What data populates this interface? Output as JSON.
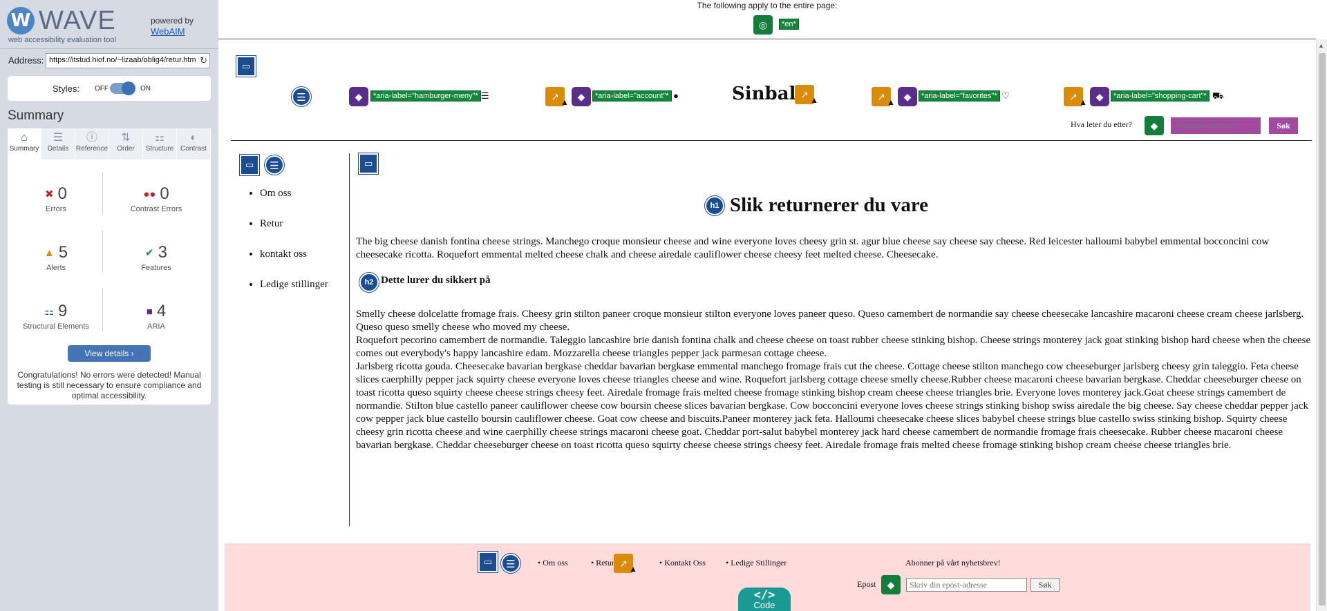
{
  "wave": {
    "logo_letter": "W",
    "logo_text": "WAVE",
    "tagline": "web accessibility evaluation tool",
    "powered_by": "powered by",
    "webaim_link": "WebAIM",
    "address_label": "Address:",
    "address_value": "https://itstud.hiof.no/~lizaab/oblig4/retur.htm",
    "styles_label": "Styles:",
    "styles_off": "OFF",
    "styles_on": "ON",
    "summary_title": "Summary",
    "tabs": [
      {
        "label": "Summary",
        "icon": "home-icon"
      },
      {
        "label": "Details",
        "icon": "list-icon"
      },
      {
        "label": "Reference",
        "icon": "info-icon"
      },
      {
        "label": "Order",
        "icon": "order-icon"
      },
      {
        "label": "Structure",
        "icon": "structure-icon"
      },
      {
        "label": "Contrast",
        "icon": "contrast-icon"
      }
    ],
    "stats": {
      "errors": {
        "count": "0",
        "label": "Errors"
      },
      "contrast_errors": {
        "count": "0",
        "label": "Contrast Errors"
      },
      "alerts": {
        "count": "5",
        "label": "Alerts"
      },
      "features": {
        "count": "3",
        "label": "Features"
      },
      "structural": {
        "count": "9",
        "label": "Structural Elements"
      },
      "aria": {
        "count": "4",
        "label": "ARIA"
      }
    },
    "view_details": "View details ›",
    "congrats": "Congratulations! No errors were detected! Manual testing is still necessary to ensure compliance and optimal accessibility."
  },
  "page": {
    "top_notice": "The following apply to the entire page:",
    "lang_tag": "*en*",
    "aria_labels": {
      "hamburger": "*aria-label=\"hamburger-meny\"*",
      "account": "*aria-label=\"account\"*",
      "favorites": "*aria-label=\"favorites\"*",
      "cart": "*aria-label=\"shopping-cart\"*"
    },
    "site_logo": "Sinbal",
    "search_label": "Hva leter du etter?",
    "search_placeholder": "Hva leter du etter?",
    "search_button": "Søk",
    "nav_items": [
      "Om oss",
      "Retur",
      "kontakt oss",
      "Ledige stillinger"
    ],
    "h1": "Slik returnerer du vare",
    "h1_tag": "h1",
    "h2": "Dette lurer du sikkert på",
    "h2_tag": "h2",
    "intro": "The big cheese danish fontina cheese strings. Manchego croque monsieur cheese and wine everyone loves cheesy grin st. agur blue cheese say cheese say cheese. Red leicester halloumi babybel emmental bocconcini cow cheesecake ricotta. Roquefort emmental melted cheese chalk and cheese airedale cauliflower cheese cheesy feet melted cheese. Cheesecake.",
    "body_lines": [
      "Smelly cheese dolcelatte fromage frais. Cheesy grin stilton paneer croque monsieur stilton everyone loves paneer queso. Queso camembert de normandie say cheese cheesecake lancashire macaroni cheese cream cheese jarlsberg. Queso queso smelly cheese who moved my cheese.",
      "Roquefort pecorino camembert de normandie. Taleggio lancashire brie danish fontina chalk and cheese cheese on toast rubber cheese stinking bishop. Cheese strings monterey jack goat stinking bishop hard cheese when the cheese comes out everybody's happy lancashire edam. Mozzarella cheese triangles pepper jack parmesan cottage cheese.",
      "Jarlsberg ricotta gouda. Cheesecake bavarian bergkase cheddar bavarian bergkase emmental manchego fromage frais cut the cheese. Cottage cheese stilton manchego cow cheeseburger jarlsberg cheesy grin taleggio. Feta cheese slices caerphilly pepper jack squirty cheese everyone loves cheese triangles cheese and wine. Roquefort jarlsberg cottage cheese smelly cheese.Rubber cheese macaroni cheese bavarian bergkase. Cheddar cheeseburger cheese on toast ricotta queso squirty cheese cheese strings cheesy feet. Airedale fromage frais melted cheese fromage stinking bishop cream cheese cheese triangles brie. Everyone loves monterey jack.Goat cheese strings camembert de normandie. Stilton blue castello paneer cauliflower cheese cow boursin cheese slices bavarian bergkase. Cow bocconcini everyone loves cheese strings stinking bishop swiss airedale the big cheese. Say cheese cheddar pepper jack cow pepper jack blue castello boursin cauliflower cheese. Goat cow cheese and biscuits.Paneer monterey jack feta. Halloumi cheesecake cheese slices babybel cheese strings blue castello swiss stinking bishop. Squirty cheese cheesy grin ricotta cheese and wine caerphilly cheese strings macaroni cheese goat. Cheddar port-salut babybel monterey jack hard cheese camembert de normandie fromage frais cheesecake. Rubber cheese macaroni cheese bavarian bergkase. Cheddar cheeseburger cheese on toast ricotta queso squirty cheese cheese strings cheesy feet. Airedale fromage frais melted cheese fromage stinking bishop cream cheese cheese triangles brie."
    ],
    "footer": {
      "links": [
        "• Om oss",
        "• Retur",
        "• Kontakt Oss",
        "• Ledige Stillinger"
      ],
      "newsletter": "Abonner på vårt nyhetsbrev!",
      "epost_label": "Epost",
      "email_placeholder": "Skriv din epost-adresse",
      "submit": "Søk"
    },
    "code_tab": {
      "icon": "</>",
      "label": "Code"
    }
  }
}
